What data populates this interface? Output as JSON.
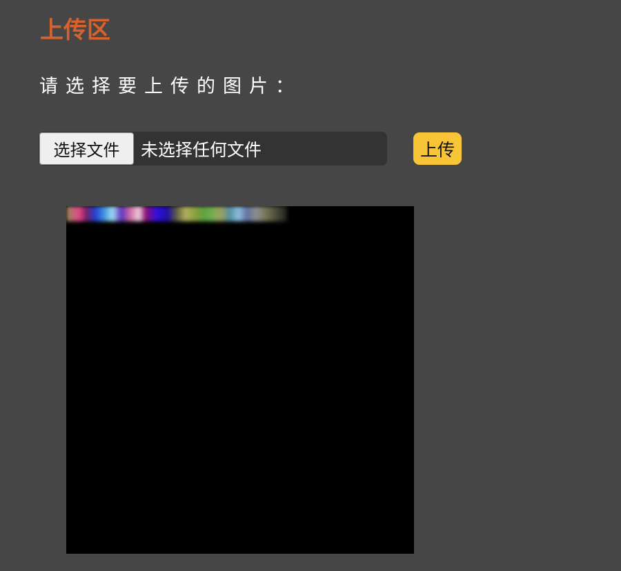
{
  "upload_section": {
    "title": "上传区",
    "prompt": "请选择要上传的图片：",
    "file_input": {
      "button_label": "选择文件",
      "status_text": "未选择任何文件"
    },
    "upload_button_label": "上传"
  },
  "colors": {
    "background": "#464646",
    "title_color": "#d9622b",
    "upload_button": "#f8c537",
    "file_input_bg": "#333333",
    "preview_bg": "#000000"
  }
}
